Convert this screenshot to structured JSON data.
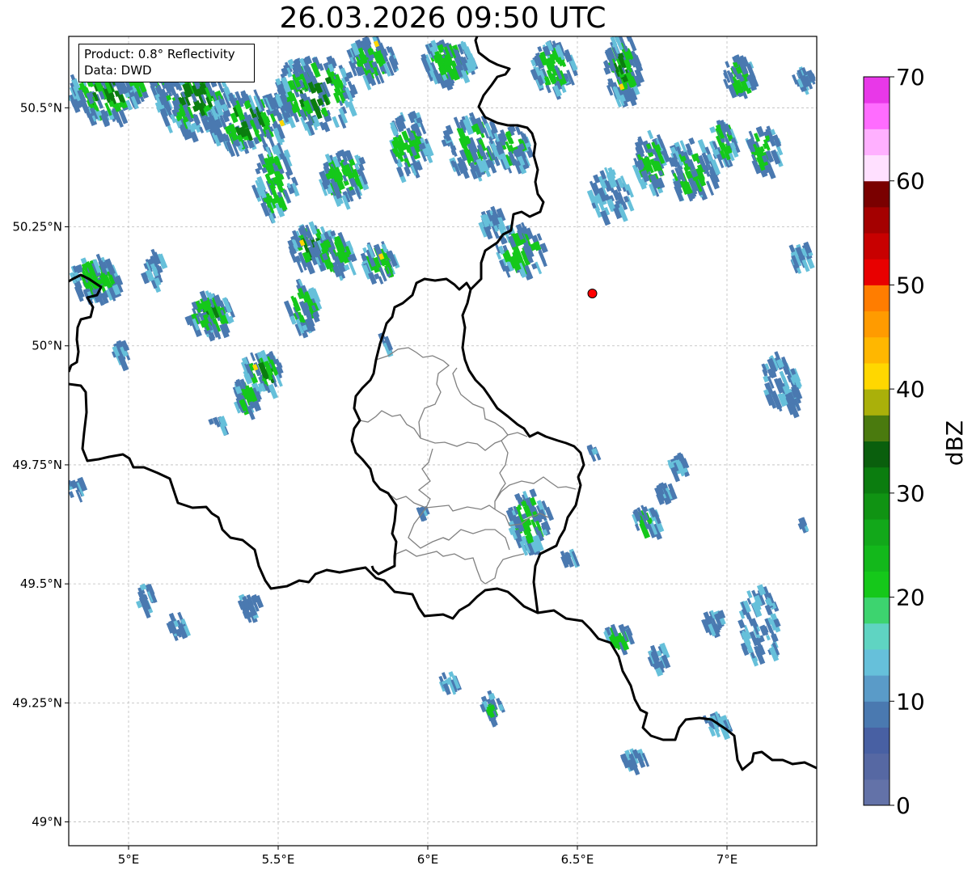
{
  "map": {
    "title": "26.03.2026 09:50 UTC",
    "info": {
      "product": "Product: 0.8° Reflectivity",
      "source": "Data: DWD"
    },
    "extent": {
      "lon": [
        4.8,
        7.3
      ],
      "lat": [
        48.95,
        50.65
      ]
    },
    "lon_ticks": [
      {
        "value": 5.0,
        "label": "5°E"
      },
      {
        "value": 5.5,
        "label": "5.5°E"
      },
      {
        "value": 6.0,
        "label": "6°E"
      },
      {
        "value": 6.5,
        "label": "6.5°E"
      },
      {
        "value": 7.0,
        "label": "7°E"
      }
    ],
    "lat_ticks": [
      {
        "value": 50.5,
        "label": "50.5°N"
      },
      {
        "value": 50.25,
        "label": "50.25°N"
      },
      {
        "value": 50.0,
        "label": "50°N"
      },
      {
        "value": 49.75,
        "label": "49.75°N"
      },
      {
        "value": 49.5,
        "label": "49.5°N"
      },
      {
        "value": 49.25,
        "label": "49.25°N"
      },
      {
        "value": 49.0,
        "label": "49°N"
      }
    ],
    "grid": true,
    "radar_site": {
      "lon": 6.55,
      "lat": 50.11,
      "color": "#ff0000"
    },
    "colorbar": {
      "label": "dBZ",
      "range": [
        0,
        70
      ],
      "tick_labels": [
        "0",
        "10",
        "20",
        "30",
        "40",
        "50",
        "60",
        "70"
      ],
      "colors": [
        "#6372a8",
        "#5668a3",
        "#4860a3",
        "#4a79b0",
        "#5a9bc8",
        "#66c0da",
        "#5fd4c2",
        "#3dd46f",
        "#15c81a",
        "#13b81b",
        "#12a81a",
        "#109313",
        "#0b7d0f",
        "#0a5f0d",
        "#4a7a0e",
        "#aab00a",
        "#ffd700",
        "#ffb700",
        "#ff9b00",
        "#ff7d00",
        "#e80000",
        "#c80000",
        "#a40000",
        "#7a0000",
        "#ffe0ff",
        "#ffb0ff",
        "#ff6cff",
        "#e838e8"
      ]
    },
    "echo_colors": {
      "weak": "#4a79b0",
      "light": "#66c0da",
      "moderate": "#15c81a",
      "strong": "#0b7d0f",
      "core": "#ffd700"
    }
  }
}
